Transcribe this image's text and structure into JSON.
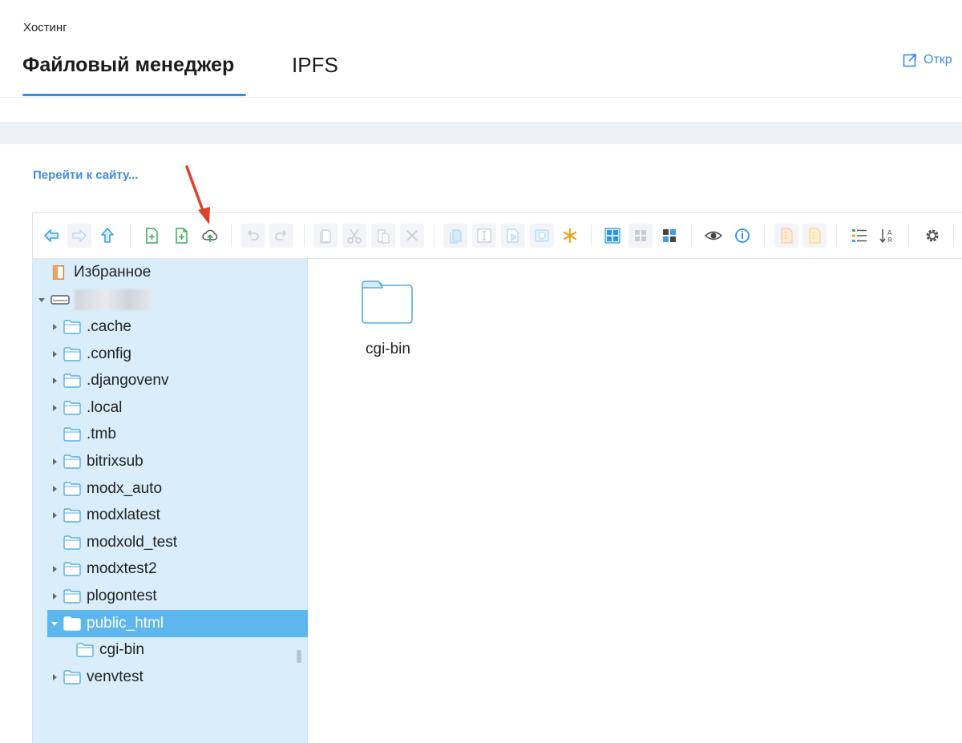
{
  "header": {
    "breadcrumb": "Хостинг",
    "tabs": [
      {
        "label": "Файловый менеджер",
        "active": true
      },
      {
        "label": "IPFS",
        "active": false
      }
    ],
    "open_link": "Откр"
  },
  "goto_site_link": "Перейти к сайту...",
  "colors": {
    "accent": "#3f8be3",
    "sidebar_bg": "#d9eefa",
    "selected_row": "#5db6ee",
    "annotation_arrow": "#d9432f"
  },
  "toolbar": {
    "buttons": [
      {
        "icon": "back-icon",
        "enabled": true
      },
      {
        "icon": "forward-icon",
        "enabled": false
      },
      {
        "icon": "up-icon",
        "enabled": true
      },
      {
        "icon": "new-folder-icon",
        "enabled": true
      },
      {
        "icon": "new-file-icon",
        "enabled": true
      },
      {
        "icon": "upload-icon",
        "enabled": true
      },
      {
        "icon": "undo-icon",
        "enabled": false
      },
      {
        "icon": "redo-icon",
        "enabled": false
      },
      {
        "icon": "copy-icon",
        "enabled": false
      },
      {
        "icon": "cut-icon",
        "enabled": false
      },
      {
        "icon": "paste-icon",
        "enabled": false
      },
      {
        "icon": "delete-icon",
        "enabled": false
      },
      {
        "icon": "duplicate-icon",
        "enabled": false
      },
      {
        "icon": "rename-icon",
        "enabled": false
      },
      {
        "icon": "edit-icon",
        "enabled": false
      },
      {
        "icon": "resize-icon",
        "enabled": false
      },
      {
        "icon": "select-all-icon",
        "enabled": true
      },
      {
        "icon": "icons-view-icon",
        "enabled": true
      },
      {
        "icon": "list-view-icon",
        "enabled": false
      },
      {
        "icon": "thumbnails-icon",
        "enabled": true
      },
      {
        "icon": "preview-icon",
        "enabled": true
      },
      {
        "icon": "info-icon",
        "enabled": true
      },
      {
        "icon": "extract-icon",
        "enabled": false
      },
      {
        "icon": "archive-icon",
        "enabled": false
      },
      {
        "icon": "view-list-icon",
        "enabled": true
      },
      {
        "icon": "sort-icon",
        "enabled": true
      },
      {
        "icon": "settings-icon",
        "enabled": true
      }
    ]
  },
  "tree": {
    "favorites": "Избранное",
    "root_label": "",
    "items": [
      {
        "label": ".cache",
        "has_children": true,
        "expanded": false,
        "level": 1
      },
      {
        "label": ".config",
        "has_children": true,
        "expanded": false,
        "level": 1
      },
      {
        "label": ".djangovenv",
        "has_children": true,
        "expanded": false,
        "level": 1
      },
      {
        "label": ".local",
        "has_children": true,
        "expanded": false,
        "level": 1
      },
      {
        "label": ".tmb",
        "has_children": false,
        "expanded": false,
        "level": 1
      },
      {
        "label": "bitrixsub",
        "has_children": true,
        "expanded": false,
        "level": 1
      },
      {
        "label": "modx_auto",
        "has_children": true,
        "expanded": false,
        "level": 1
      },
      {
        "label": "modxlatest",
        "has_children": true,
        "expanded": false,
        "level": 1
      },
      {
        "label": "modxold_test",
        "has_children": false,
        "expanded": false,
        "level": 1
      },
      {
        "label": "modxtest2",
        "has_children": true,
        "expanded": false,
        "level": 1
      },
      {
        "label": "plogontest",
        "has_children": true,
        "expanded": false,
        "level": 1
      },
      {
        "label": "public_html",
        "has_children": true,
        "expanded": true,
        "selected": true,
        "level": 1
      },
      {
        "label": "cgi-bin",
        "has_children": false,
        "expanded": false,
        "level": 2
      },
      {
        "label": "venvtest",
        "has_children": true,
        "expanded": false,
        "level": 1
      }
    ]
  },
  "content": {
    "items": [
      {
        "name": "cgi-bin",
        "type": "folder"
      }
    ]
  }
}
